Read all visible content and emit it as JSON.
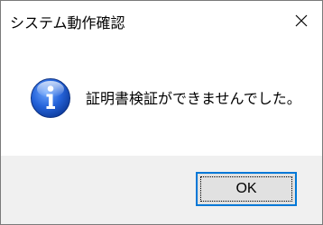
{
  "window": {
    "title": "システム動作確認"
  },
  "message": {
    "icon": "info-icon",
    "text": "証明書検証ができませんでした。"
  },
  "buttons": {
    "ok_label": "OK",
    "close_icon": "close-icon"
  },
  "colors": {
    "focus_border": "#0078d7",
    "footer_bg": "#f0f0f0",
    "button_bg": "#e1e1e1",
    "icon_blue": "#1f5fd6"
  }
}
